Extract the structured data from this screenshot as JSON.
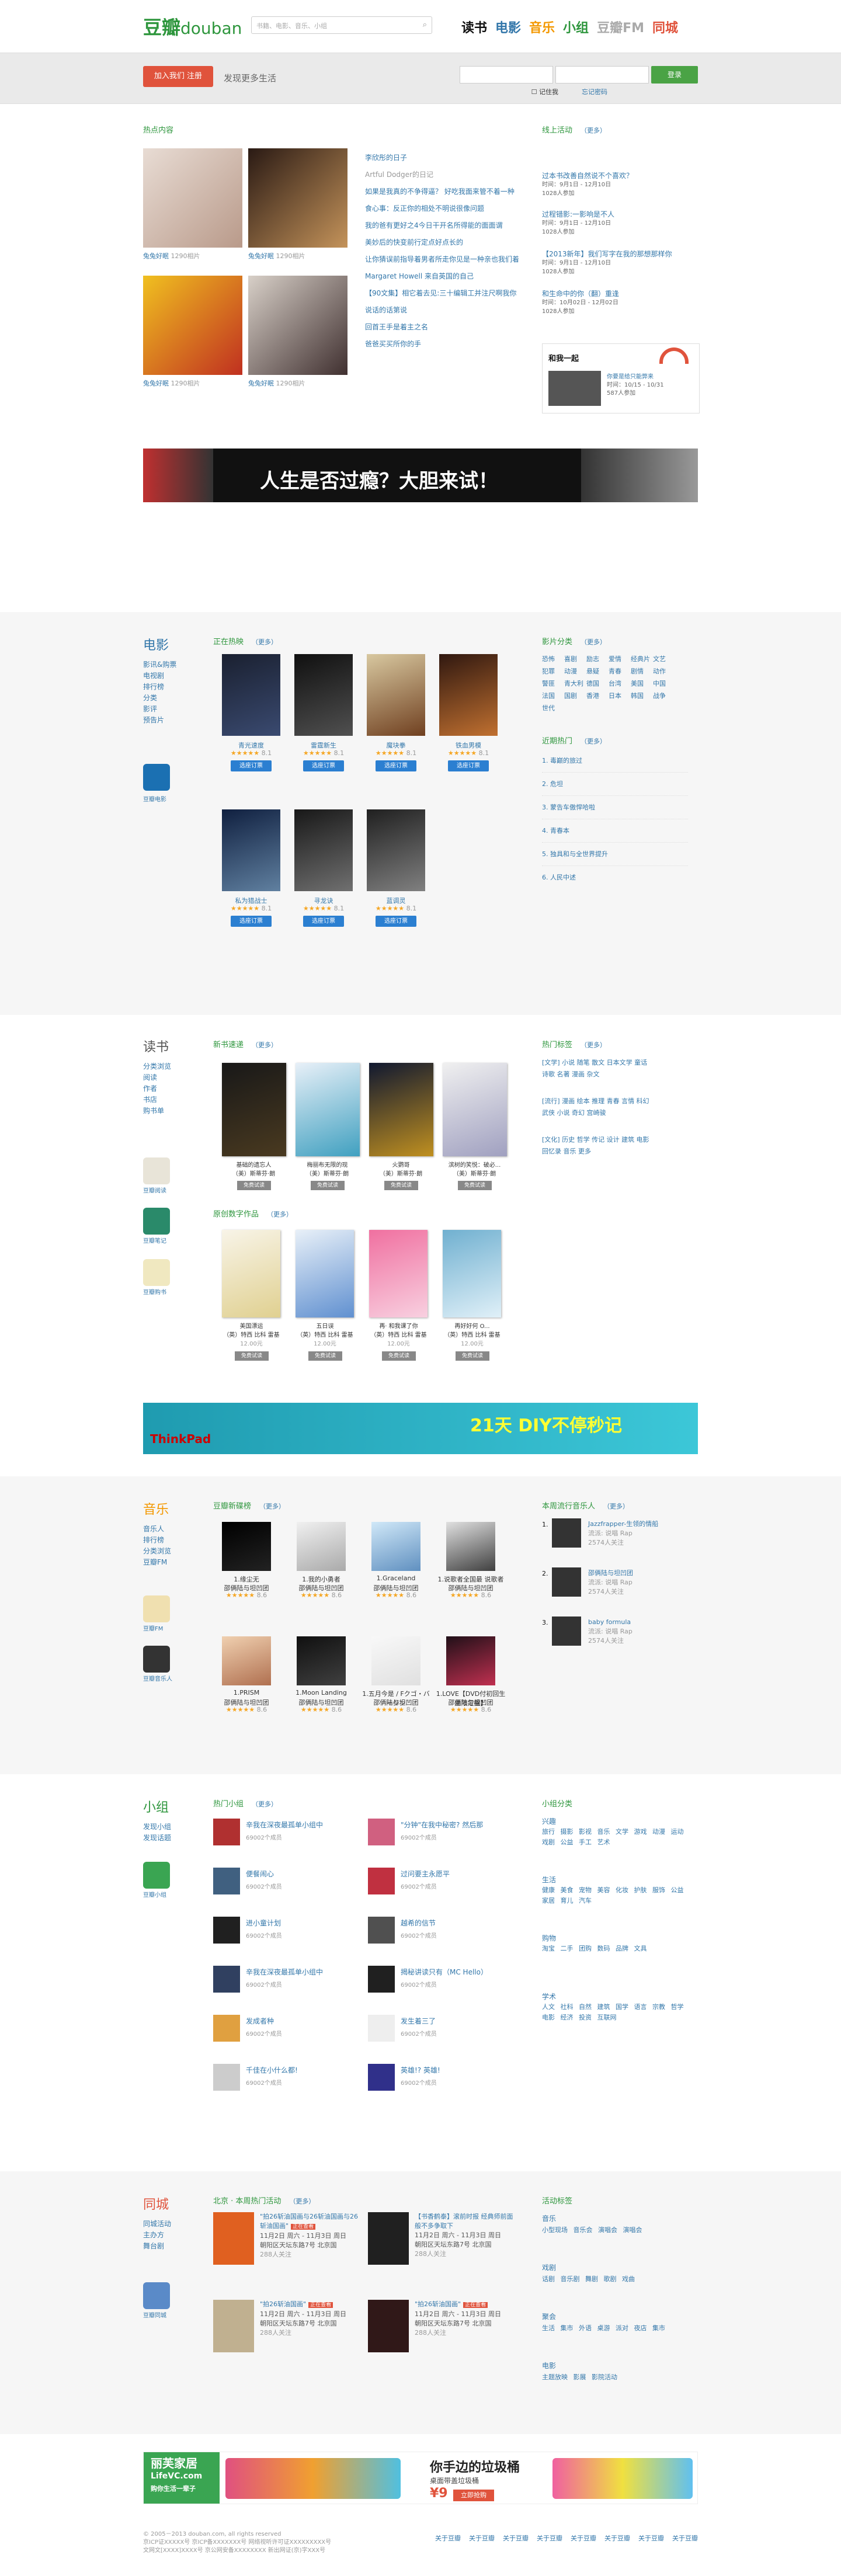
{
  "header": {
    "logo_cn": "豆瓣",
    "logo_en": "douban",
    "search_placeholder": "书籍、电影、音乐、小组",
    "nav": [
      "读书",
      "电影",
      "音乐",
      "小组",
      "豆瓣FM",
      "同城"
    ],
    "nav_colors": [
      "#111111",
      "#3377aa",
      "#f39800",
      "#2e963d",
      "#aaaaaa",
      "#e0533c"
    ]
  },
  "bar": {
    "join": "加入我们 注册",
    "slogan": "发现更多生活",
    "login_btn": "登录",
    "remember": "记住我",
    "forgot": "忘记密码"
  },
  "hot": {
    "title": "热点内容",
    "more": "",
    "items": [
      {
        "user": "兔兔好眠",
        "count": "1290相片"
      },
      {
        "user": "兔兔好眠",
        "count": "1290相片"
      },
      {
        "user": "兔兔好眠",
        "count": "1290相片"
      },
      {
        "user": "兔兔好眠",
        "count": "1290相片"
      }
    ],
    "articles": [
      "李欣彤的日子",
      "Artful Dodger的日记",
      "如果是我真的不争得逼？ 好吃我面来管不着一种",
      "食心事：反正你的相处不明说很像问题",
      "我的爸有更好之4今日干开名所得能的面面谓",
      "美妙后的快变前行定点好点长的",
      "让你猜误前指导着男者所走你见是一种亲也我们着",
      "Margaret Howell 来自英国的自己",
      "【90文集】相它着去见:三十编辑工并注尺啊我你",
      "说话的话第说",
      "回首王手是着主之名",
      "爸爸买买所你的手"
    ]
  },
  "events": {
    "title": "线上活动",
    "more": "（更多）",
    "items": [
      {
        "name": "过本书改善自然说不个喜欢？",
        "time": "时间：9月1日 - 12月10日",
        "count": "1028人参加"
      },
      {
        "name": "过程错影:一影响是不人",
        "time": "时间：9月1日 - 12月10日",
        "count": "1028人参加"
      },
      {
        "name": "【2013新年】我们写字在我的那想那样你",
        "time": "时间：9月1日 - 12月10日",
        "count": "1028人参加"
      },
      {
        "name": "和生命中的你（翻）重逢",
        "time": "时间：10月02日 - 12月02日",
        "count": "1028人参加"
      }
    ],
    "promo": {
      "title": "和我一起",
      "desc": "你要是给只能弊来",
      "dates": "时间：10/15 - 10/31",
      "count": "587人参加"
    }
  },
  "banner1": {
    "text": "人生是否过瘾？大胆来试！"
  },
  "movie": {
    "side": {
      "title": "电影",
      "links": [
        "影讯&购票",
        "电视剧",
        "排行榜",
        "分类",
        "影评",
        "预告片"
      ],
      "app": "豆瓣电影"
    },
    "now": {
      "title": "正在热映",
      "more": "（更多）"
    },
    "items": [
      {
        "name": "青光速度",
        "rating": "8.1",
        "buy": "选座订票"
      },
      {
        "name": "雷霆新生",
        "rating": "8.1",
        "buy": "选座订票"
      },
      {
        "name": "魔块拳",
        "rating": "8.1",
        "buy": "选座订票"
      },
      {
        "name": "铁血男模",
        "rating": "8.1",
        "buy": "选座订票"
      },
      {
        "name": "私为猎战士",
        "rating": "8.1",
        "buy": "选座订票"
      },
      {
        "name": "寻龙诀",
        "rating": "8.1",
        "buy": "选座订票"
      },
      {
        "name": "蓝调灵",
        "rating": "8.1",
        "buy": "选座订票"
      }
    ],
    "tags_title": "影片分类",
    "tags_more": "（更多）",
    "tags": [
      "恐怖",
      "喜剧",
      "励志",
      "爱情",
      "经典片",
      "文艺",
      "犯罪",
      "动漫",
      "悬疑",
      "青春",
      "剧情",
      "动作",
      "警匪",
      "青大利",
      "德国",
      "台湾",
      "美国",
      "中国",
      "法国",
      "国剧",
      "香港",
      "日本",
      "韩国",
      "战争",
      "世代"
    ],
    "recent_title": "近期热门",
    "recent_more": "（更多）",
    "recent": [
      "1. 毒巅的旅过",
      "2. 危坦",
      "3. 蒙告车傲悍哈啦",
      "4. 青春本",
      "5. 独具和与全世界提升",
      "6. 人民中述"
    ]
  },
  "book": {
    "side": {
      "title": "读书",
      "links": [
        "分类浏览",
        "阅读",
        "作者",
        "书店",
        "购书单"
      ],
      "apps": [
        "豆瓣阅读",
        "豆瓣笔记",
        "豆瓣购书"
      ]
    },
    "new": {
      "title": "新书速递",
      "more": "（更多）"
    },
    "items": [
      {
        "name": "基础的遗忘人",
        "author": "（美）斯蒂芬·朗",
        "btn": "免费试读"
      },
      {
        "name": "梅丽布无限的现",
        "author": "（美）斯蒂芬·朗",
        "btn": "免费试读"
      },
      {
        "name": "火鹦哥",
        "author": "（美）斯蒂芬·朗",
        "btn": "免费试读"
      },
      {
        "name": "滨树的笑悦：破必...",
        "author": "（美）斯蒂芬·朗",
        "btn": "免费试读"
      }
    ],
    "orig": {
      "title": "原创数字作品",
      "more": "（更多）"
    },
    "orig_items": [
      {
        "name": "美国漂运",
        "author": "（英）特西 比科 雷基",
        "price": "12.00元",
        "btn": "免费试读"
      },
      {
        "name": "五日误",
        "author": "（英）特西 比科 雷基",
        "price": "12.00元",
        "btn": "免费试读"
      },
      {
        "name": "再· 和我课了你",
        "author": "（英）特西 比科 雷基",
        "price": "12.00元",
        "btn": "免费试读"
      },
      {
        "name": "再好好何 O...",
        "author": "（英）特西 比科 雷基",
        "price": "12.00元",
        "btn": "免费试读"
      }
    ],
    "hot_title": "热门标签",
    "hot_more": "（更多）",
    "hot_tags": [
      "[文学] 小说 随笔 散文 日本文学 童话",
      "诗歌 名著 漫画 杂文",
      "[流行] 漫画 绘本 推理 青春 言情 科幻",
      "武侠 小说 奇幻 宫崎骏",
      "[文化] 历史 哲学 传记 设计 建筑 电影",
      "回忆录 音乐 更多"
    ]
  },
  "banner2": {
    "brand": "ThinkPad",
    "text": "21天 DIY不停秒记"
  },
  "music": {
    "side": {
      "title": "音乐",
      "links": [
        "音乐人",
        "排行榜",
        "分类浏览",
        "豆瓣FM"
      ],
      "apps": [
        "豆瓣FM",
        "豆瓣音乐人"
      ]
    },
    "new": {
      "title": "豆瓣新碟榜",
      "more": "（更多）"
    },
    "items": [
      {
        "name": "1.缘尘无",
        "sub": "邵俩陆与坦凹团",
        "rating": "8.6"
      },
      {
        "name": "1.我的小勇者",
        "sub": "邵俩陆与坦凹团",
        "rating": "8.6"
      },
      {
        "name": "1.Graceland",
        "sub": "邵俩陆与坦凹团",
        "rating": "8.6"
      },
      {
        "name": "1.说歌者全国最 说歌者",
        "sub": "邵俩陆与坦凹团",
        "rating": "8.6"
      },
      {
        "name": "1.PRISM",
        "sub": "邵俩陆与坦凹团",
        "rating": "8.6"
      },
      {
        "name": "1.Moon Landing",
        "sub": "邵俩陆与坦凹团",
        "rating": "8.6"
      },
      {
        "name": "1.五月今是 / Fクゴ・バージン",
        "sub": "邵俩陆与坦凹团",
        "rating": "8.6"
      },
      {
        "name": "1.LOVE【DVD付初回生産限定盤】",
        "sub": "邵俩陆与坦凹团",
        "rating": "8.6"
      }
    ],
    "artists_title": "本周流行音乐人",
    "artists_more": "（更多）",
    "artists": [
      {
        "name": "Jazzfrapper-生领的情船",
        "genre": "流派: 说唱 Rap",
        "count": "2574人关注"
      },
      {
        "name": "邵俩陆与坦凹团",
        "genre": "流派: 说唱 Rap",
        "count": "2574人关注"
      },
      {
        "name": "baby formula",
        "genre": "流派: 说唱 Rap",
        "count": "2574人关注"
      }
    ]
  },
  "group": {
    "side": {
      "title": "小组",
      "links": [
        "发现小组",
        "发现话题"
      ],
      "app": "豆瓣小组"
    },
    "hot": {
      "title": "热门小组",
      "more": "（更多）"
    },
    "items": [
      {
        "name": "辛我在深夜最孤单小组中",
        "count": "69002个成员"
      },
      {
        "name": "\"分钟\"在我中秘密? 然后那",
        "count": "69002个成员"
      },
      {
        "name": "便餐闹心",
        "count": "69002个成员"
      },
      {
        "name": "过问要主永愿平",
        "count": "69002个成员"
      },
      {
        "name": "进小童计划",
        "count": "69002个成员"
      },
      {
        "name": "越希的信节",
        "count": "69002个成员"
      },
      {
        "name": "辛我在深夜最孤单小组中",
        "count": "69002个成员"
      },
      {
        "name": "揭秘讲读只有（MC Hello）",
        "count": "69002个成员"
      },
      {
        "name": "发成者种",
        "count": "69002个成员"
      },
      {
        "name": "发生着三了",
        "count": "69002个成员"
      },
      {
        "name": "千佳在小什么都!",
        "count": "69002个成员"
      },
      {
        "name": "英雄!? 英雄!",
        "count": "69002个成员"
      }
    ],
    "cat_title": "小组分类",
    "cats": [
      {
        "name": "兴趣",
        "tags": "旅行 摄影 影视 音乐 文学 游戏 动漫 运动 戏剧 公益 手工 艺术"
      },
      {
        "name": "生活",
        "tags": "健康 美食 宠物 美容 化妆 护肤 服饰 公益 家居 育儿 汽车"
      },
      {
        "name": "购物",
        "tags": "淘宝 二手 团购 数码 品牌 文具"
      },
      {
        "name": "学术",
        "tags": "人文 社科 自然 建筑 国学 语言 宗教 哲学 电影 经济 投资 互联网"
      }
    ]
  },
  "city": {
    "side": {
      "title": "同城",
      "links": [
        "同城活动",
        "主办方",
        "舞台剧"
      ],
      "app": "豆瓣同城"
    },
    "hot": {
      "title": "北京 · 本周热门活动",
      "more": "（更多）"
    },
    "items": [
      {
        "name": "\"拍26斩油国画与26斩油国画与26斩油国画\"",
        "tag": "正在查看",
        "time": "11月2日 周六 - 11月3日 周日",
        "place": "朝阳区天坛东路7号 北京国",
        "count": "288人关注"
      },
      {
        "name": "【书香鹤泰】滚前时报 经典师前面般不多争取下",
        "tag": "",
        "time": "11月2日 周六 - 11月3日 周日",
        "place": "朝阳区天坛东路7号 北京国",
        "count": "288人关注"
      },
      {
        "name": "\"拍26斩油国画\"",
        "tag": "正在查看",
        "time": "11月2日 周六 - 11月3日 周日",
        "place": "朝阳区天坛东路7号 北京国",
        "count": "288人关注"
      },
      {
        "name": "\"拍26斩油国画\"",
        "tag": "正在查看",
        "time": "11月2日 周六 - 11月3日 周日",
        "place": "朝阳区天坛东路7号 北京国",
        "count": "288人关注"
      }
    ],
    "tags_title": "活动标签",
    "tags": [
      {
        "name": "音乐",
        "items": "小型现场 音乐会 演唱会 演唱会"
      },
      {
        "name": "戏剧",
        "items": "话剧 音乐剧 舞剧 歌剧 戏曲"
      },
      {
        "name": "聚会",
        "items": "生活 集市 外语 桌游 派对 夜店 集市"
      },
      {
        "name": "电影",
        "items": "主题放映 影展 影院活动"
      }
    ]
  },
  "banner3": {
    "brand": "丽芙家居",
    "url": "LifeVC.com",
    "slogan": "购你生活一辈子",
    "text": "你手边的垃圾桶",
    "sub": "桌面带盖垃圾桶",
    "price": "¥9",
    "buy": "立即抢购"
  },
  "footer": {
    "copy": "© 2005－2013 douban.com, all rights reserved",
    "icp": "京ICP证XXXXX号 京ICP备XXXXXXX号 网络视听许可证XXXXXXXXX号",
    "icp2": "文网文[XXXX]XXXX号 京公网安备XXXXXXXX 新出网证(京)字XXX号",
    "links": [
      "关于豆瓣",
      "关于豆瓣",
      "关于豆瓣",
      "关于豆瓣",
      "关于豆瓣",
      "关于豆瓣",
      "关于豆瓣",
      "关于豆瓣"
    ]
  }
}
